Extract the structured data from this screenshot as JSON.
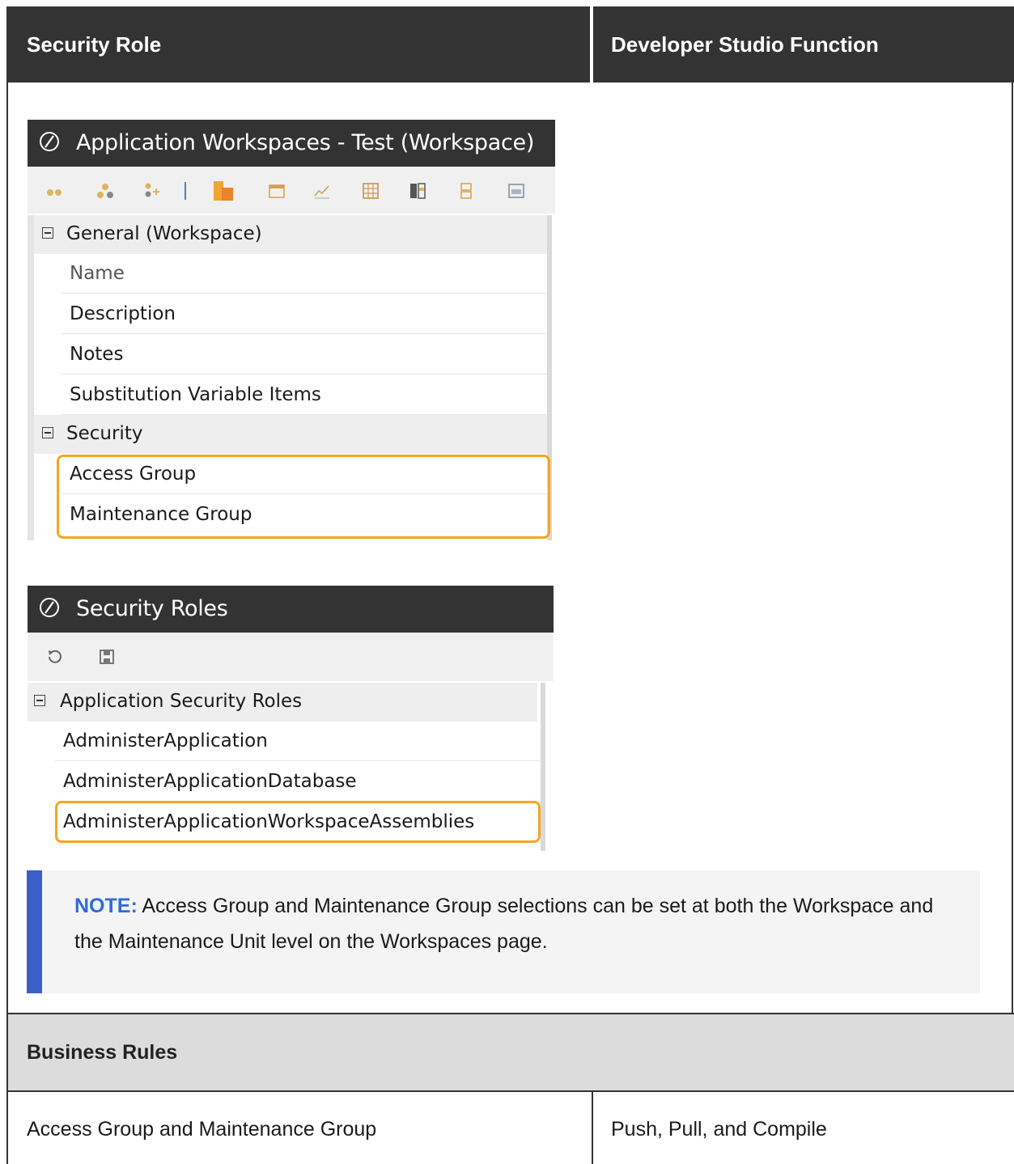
{
  "table": {
    "headers": [
      "Security Role",
      "Developer Studio Function"
    ]
  },
  "screenshot1": {
    "title": "Application Workspaces - Test (Workspace)",
    "toolbar_icons": [
      "dots-icon",
      "people-icon",
      "add-person-icon",
      "separator",
      "add-package-icon",
      "window-icon",
      "chart-icon",
      "grid-icon",
      "columns-icon",
      "split-icon",
      "panel-icon"
    ],
    "categories": [
      {
        "label": "General (Workspace)",
        "items": [
          "Name",
          "Description",
          "Notes",
          "Substitution Variable Items"
        ]
      },
      {
        "label": "Security",
        "items": [
          "Access Group",
          "Maintenance Group"
        ]
      }
    ],
    "accent": "#f5a623"
  },
  "screenshot2": {
    "title": "Security Roles",
    "toolbar_icons": [
      "refresh-icon",
      "save-icon"
    ],
    "category": "Application Security Roles",
    "items": [
      "AdministerApplication",
      "AdministerApplicationDatabase",
      "AdministerApplicationWorkspaceAssemblies"
    ]
  },
  "note": {
    "tag": "NOTE:",
    "text": " Access Group and Maintenance Group selections can be set at both the Workspace and the Maintenance Unit level on the Workspaces page."
  },
  "section": {
    "title": "Business Rules"
  },
  "row": {
    "role": "Access Group and Maintenance Group",
    "function": "Push, Pull, and Compile"
  }
}
